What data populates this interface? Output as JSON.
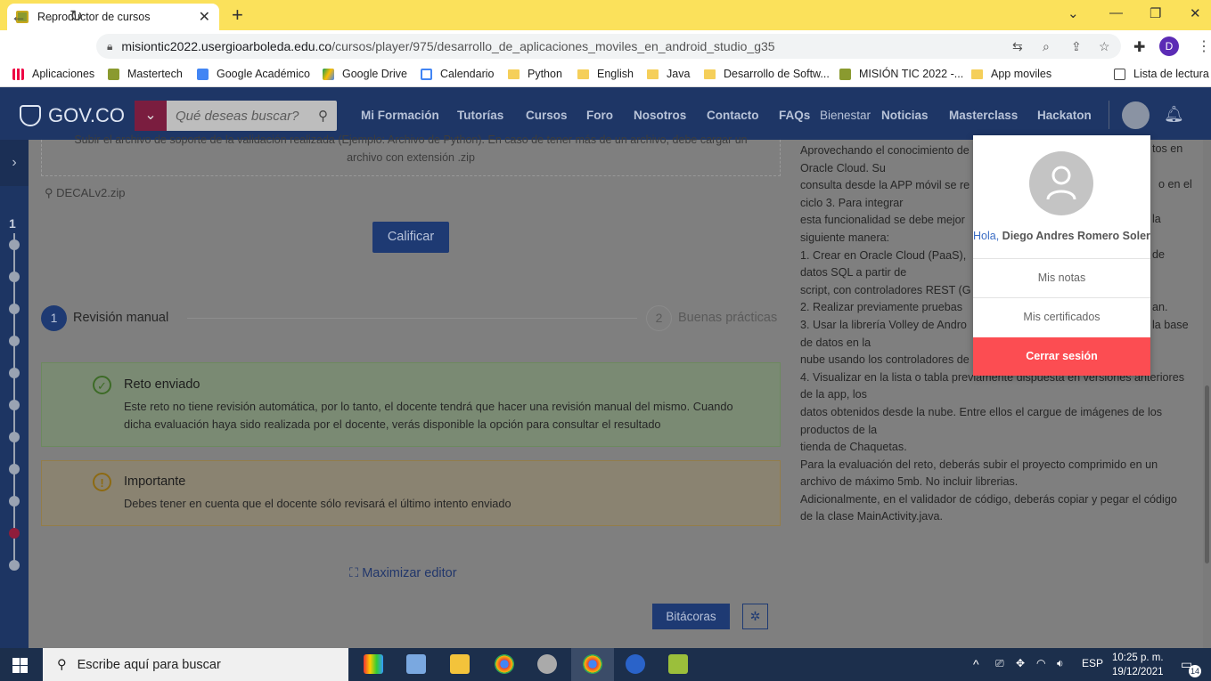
{
  "browser": {
    "tab_title": "Reproductor de cursos",
    "tab_close": "✕",
    "new_tab": "+",
    "url_host": "misiontic2022.usergioarboleda.edu.co",
    "url_path": "/cursos/player/975/desarrollo_de_aplicaciones_moviles_en_android_studio_g35",
    "profile_initial": "D",
    "bookmarks": [
      "Aplicaciones",
      "Mastertech",
      "Google Académico",
      "Google Drive",
      "Calendario",
      "Python",
      "English",
      "Java",
      "Desarrollo de Softw...",
      "MISIÓN TIC 2022 -...",
      "App moviles"
    ],
    "reading_list": "Lista de lectura"
  },
  "header": {
    "logo": "GOV.CO",
    "search_placeholder": "Qué deseas buscar?",
    "menu": [
      "Mi Formación",
      "Tutorías",
      "Cursos",
      "Foro",
      "Nosotros",
      "Contacto",
      "FAQs",
      "Bienestar",
      "Noticias",
      "Masterclass",
      "Hackaton"
    ]
  },
  "main": {
    "upload_hint_1": "Subir el archivo de soporte de la validación realizada (Ejemplo: Archivo de Python). En caso de tener más de un archivo, debe cargar un",
    "upload_hint_2": "archivo con extensión .zip",
    "file_name": "DECALv2.zip",
    "grade_button": "Calificar",
    "step1_num": "1",
    "step1_label": "Revisión manual",
    "step2_num": "2",
    "step2_label": "Buenas prácticas",
    "alert_sent_title": "Reto enviado",
    "alert_sent_text_1": "Este reto no tiene revisión automática, por lo tanto, el docente tendrá que hacer una revisión manual del mismo. Cuando",
    "alert_sent_text_2": "dicha evaluación haya sido realizada por el docente, verás disponible la opción para consultar el resultado",
    "alert_important_title": "Importante",
    "alert_important_text": "Debes tener en cuenta que el docente sólo revisará el último intento enviado",
    "maximize": "Maximizar editor",
    "logs_button": "Bitácoras",
    "sidebar_number": "1"
  },
  "description": [
    "Aprovechando el conocimiento de",
    "Oracle Cloud. Su",
    "consulta desde la APP móvil se re",
    "ciclo 3. Para integrar",
    "esta funcionalidad se debe mejor",
    "siguiente manera:",
    "1. Crear en Oracle Cloud (PaaS),",
    "datos SQL a partir de",
    "script, con controladores REST (G",
    "2. Realizar previamente pruebas",
    "3. Usar la librería Volley de Andro",
    "de datos en la",
    "nube usando los controladores de",
    "4. Visualizar en la lista o tabla previamente dispuesta en versiones anteriores de la app, los",
    "datos obtenidos desde la nube. Entre ellos el cargue de imágenes de los productos de la",
    "tienda de Chaquetas.",
    "Para la evaluación del reto, deberás subir el proyecto comprimido en un archivo de máximo 5mb. No incluir librerias.",
    "Adicionalmente, en el validador de código, deberás copiar y pegar el código de la clase MainActivity.java."
  ],
  "description_right": [
    "tos en",
    "o en el",
    "la",
    "de",
    "an.",
    "la base"
  ],
  "user_menu": {
    "hello": "Hola,",
    "name": "Diego Andres Romero Soler",
    "grades": "Mis notas",
    "certificates": "Mis certificados",
    "logout": "Cerrar sesión"
  },
  "taskbar": {
    "search_placeholder": "Escribe aquí para buscar",
    "lang": "ESP",
    "time": "10:25 p. m.",
    "date": "19/12/2021",
    "notifications": "14"
  }
}
